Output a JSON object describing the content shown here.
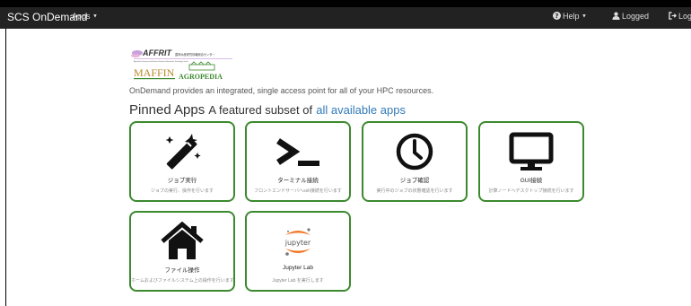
{
  "navbar": {
    "brand": "SCS OnDemand",
    "apps_label": "Apps",
    "help_label": "Help",
    "user_label": "Logged",
    "logout_label": "Log"
  },
  "logo": {
    "affrit": "AFFRIT",
    "affrit_jp": "農林水産研究情報総合センター",
    "affrit_en": "Agriculture, Forestry and Fisheries Research Information Technology Center",
    "maffin": "MAFFIN",
    "agropedia": "AGROPEDIA"
  },
  "tagline": "OnDemand provides an integrated, single access point for all of your HPC resources.",
  "pinned": {
    "title": "Pinned Apps",
    "subtitle": "A featured subset of",
    "link": "all available apps"
  },
  "cards": [
    {
      "title": "ジョブ実行",
      "desc": "ジョブの実行、操作を行います",
      "icon": "magic-wand-icon"
    },
    {
      "title": "ターミナル接続",
      "desc": "フロントエンドサーバへssh接続を行います",
      "icon": "terminal-icon"
    },
    {
      "title": "ジョブ確認",
      "desc": "実行中のジョブの状態確認を行います",
      "icon": "clock-icon"
    },
    {
      "title": "GUI接続",
      "desc": "計算ノードへデスクトップ接続を行います",
      "icon": "monitor-icon"
    },
    {
      "title": "ファイル操作",
      "desc": "ホームおよびファイルシステム上の操作を行います",
      "icon": "home-icon"
    },
    {
      "title": "Jupyter Lab",
      "desc": "Jupyter Lab を実行します",
      "icon": "jupyter-icon",
      "icon_text": "jupyter"
    }
  ],
  "colors": {
    "navbar": "#222222",
    "card_border": "#3c8a2e",
    "link": "#337ab7"
  }
}
